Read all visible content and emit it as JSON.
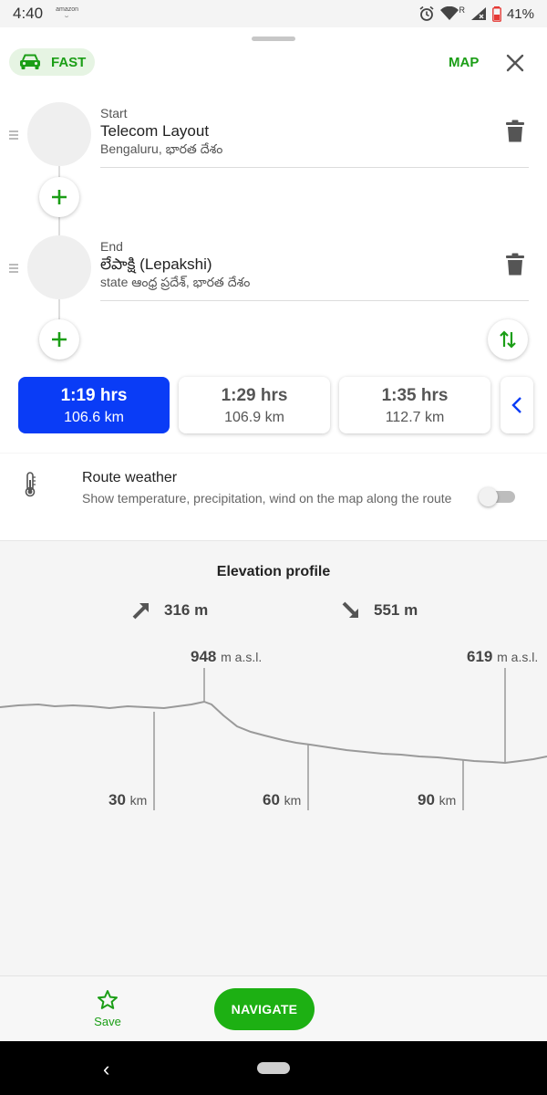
{
  "status_bar": {
    "time": "4:40",
    "notification": "amazon",
    "network": "R",
    "battery": "41%"
  },
  "header": {
    "mode_label": "FAST",
    "map_label": "MAP"
  },
  "waypoints": [
    {
      "role": "Start",
      "name": "Telecom Layout",
      "subtitle": "Bengaluru, భారత దేశం"
    },
    {
      "role": "End",
      "name": "లేపాక్షి (Lepakshi)",
      "subtitle": "state ఆంధ్ర ప్రదేశ్, భారత దేశం"
    }
  ],
  "routes": [
    {
      "time": "1:19 hrs",
      "distance": "106.6 km",
      "selected": true
    },
    {
      "time": "1:29 hrs",
      "distance": "106.9 km",
      "selected": false
    },
    {
      "time": "1:35 hrs",
      "distance": "112.7 km",
      "selected": false
    }
  ],
  "weather": {
    "title": "Route weather",
    "description": "Show temperature, precipitation, wind on the map along the route",
    "enabled": false
  },
  "elevation": {
    "title": "Elevation profile",
    "ascent": "316 m",
    "descent": "551 m",
    "max_label": {
      "value": "948",
      "unit": "m a.s.l."
    },
    "min_label": {
      "value": "619",
      "unit": "m a.s.l."
    },
    "distance_ticks": [
      {
        "value": "30",
        "unit": "km"
      },
      {
        "value": "60",
        "unit": "km"
      },
      {
        "value": "90",
        "unit": "km"
      }
    ]
  },
  "bottom_bar": {
    "save_label": "Save",
    "navigate_label": "NAVIGATE"
  },
  "colors": {
    "accent_green": "#1b9e16",
    "selected_route": "#0a3cf6",
    "navigate_button": "#1db013"
  }
}
